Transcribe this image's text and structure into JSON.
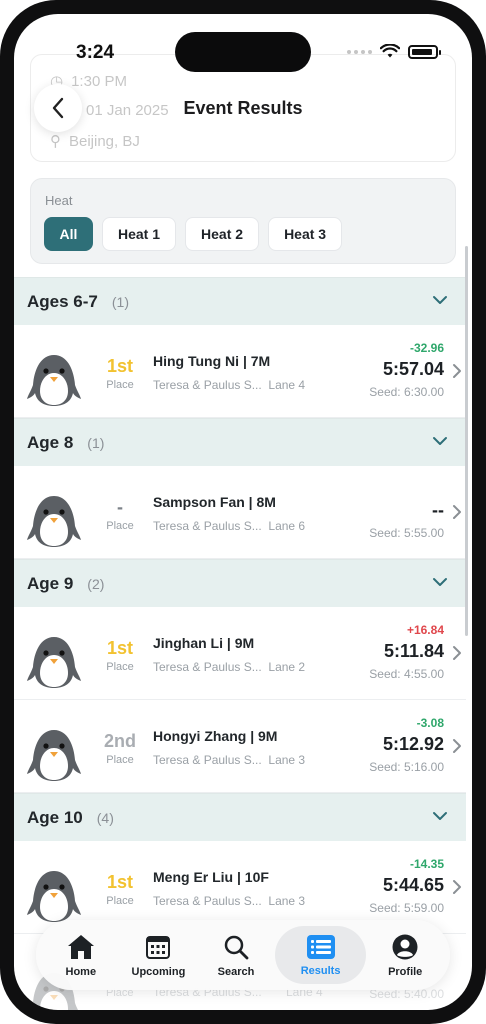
{
  "status_bar": {
    "time": "3:24"
  },
  "background_event": {
    "time": "1:30 PM",
    "date": "01 Jan 2025",
    "location": "Beijing, BJ"
  },
  "header": {
    "title": "Event Results"
  },
  "heat_filter": {
    "label": "Heat",
    "options": [
      "All",
      "Heat 1",
      "Heat 2",
      "Heat 3"
    ],
    "selected": "All"
  },
  "groups": [
    {
      "title": "Ages 6-7",
      "count": "(1)",
      "results": [
        {
          "rank": "1st",
          "place_label": "Place",
          "name": "Hing Tung Ni | 7M",
          "team": "Teresa & Paulus S...",
          "lane": "Lane 4",
          "diff": "-32.96",
          "final": "5:57.04",
          "seed": "Seed: 6:30.00"
        }
      ]
    },
    {
      "title": "Age 8",
      "count": "(1)",
      "results": [
        {
          "rank": "-",
          "place_label": "Place",
          "name": "Sampson Fan | 8M",
          "team": "Teresa & Paulus S...",
          "lane": "Lane 6",
          "diff": "",
          "final": "--",
          "seed": "Seed: 5:55.00"
        }
      ]
    },
    {
      "title": "Age 9",
      "count": "(2)",
      "results": [
        {
          "rank": "1st",
          "place_label": "Place",
          "name": "Jinghan Li | 9M",
          "team": "Teresa & Paulus S...",
          "lane": "Lane 2",
          "diff": "+16.84",
          "final": "5:11.84",
          "seed": "Seed: 4:55.00"
        },
        {
          "rank": "2nd",
          "place_label": "Place",
          "name": "Hongyi Zhang | 9M",
          "team": "Teresa & Paulus S...",
          "lane": "Lane 3",
          "diff": "-3.08",
          "final": "5:12.92",
          "seed": "Seed: 5:16.00"
        }
      ]
    },
    {
      "title": "Age 10",
      "count": "(4)",
      "results": [
        {
          "rank": "1st",
          "place_label": "Place",
          "name": "Meng Er Liu | 10F",
          "team": "Teresa & Paulus S...",
          "lane": "Lane 3",
          "diff": "-14.35",
          "final": "5:44.65",
          "seed": "Seed: 5:59.00"
        }
      ]
    }
  ],
  "partial_row": {
    "place_label": "Place",
    "team": "Teresa & Paulus S...",
    "lane": "Lane 4",
    "seed": "Seed: 5:40.00"
  },
  "tab_bar": {
    "tabs": [
      {
        "label": "Home",
        "icon": "house-icon"
      },
      {
        "label": "Upcoming",
        "icon": "calendar-icon"
      },
      {
        "label": "Search",
        "icon": "search-icon"
      },
      {
        "label": "Results",
        "icon": "list-icon"
      },
      {
        "label": "Profile",
        "icon": "person-icon"
      }
    ],
    "active": "Results"
  },
  "colors": {
    "accent": "#2e6f78",
    "group_bg": "#e6f0ef",
    "gold": "#f2c230",
    "silver": "#a9adb2",
    "negative_diff": "#2fa76b",
    "positive_diff": "#e0474c",
    "tab_active": "#1f8ff2"
  }
}
